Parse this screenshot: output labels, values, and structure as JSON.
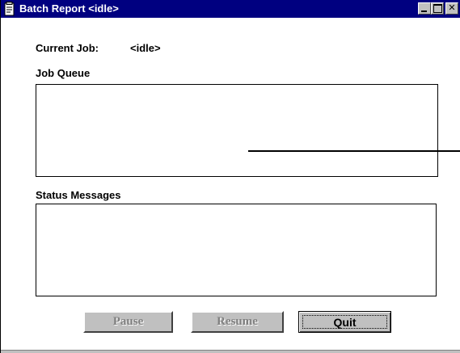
{
  "window": {
    "title": "Batch Report <idle>",
    "icon": "report-icon",
    "controls": {
      "minimize": "minimize-icon",
      "maximize": "maximize-icon",
      "close": "✕"
    }
  },
  "current_job": {
    "label": "Current Job:",
    "value": "<idle>"
  },
  "job_queue": {
    "label": "Job Queue",
    "items": []
  },
  "status_messages": {
    "label": "Status Messages",
    "items": []
  },
  "buttons": {
    "pause": "Pause",
    "resume": "Resume",
    "quit": "Quit"
  },
  "colors": {
    "titlebar": "#000080",
    "button_face": "#c0c0c0",
    "disabled_text": "#808080"
  }
}
